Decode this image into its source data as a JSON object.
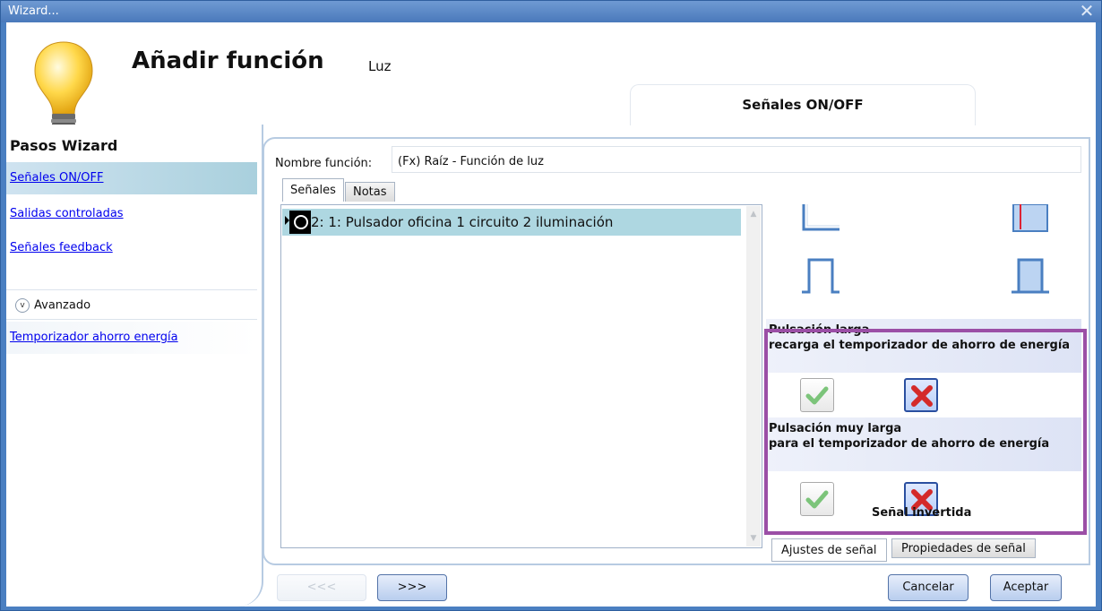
{
  "window": {
    "title": "Wizard...",
    "close_glyph": "✕"
  },
  "header": {
    "title": "Añadir función",
    "subtitle": "Luz",
    "step_tab": "Señales ON/OFF"
  },
  "sidebar": {
    "title": "Pasos Wizard",
    "items": [
      {
        "label": "Señales ON/OFF"
      },
      {
        "label": "Salidas controladas"
      },
      {
        "label": "Señales feedback"
      }
    ],
    "advanced_label": "Avanzado",
    "advanced_items": [
      {
        "label": "Temporizador ahorro energía"
      }
    ]
  },
  "form": {
    "name_label": "Nombre función:",
    "name_value": "(Fx) Raíz - Función de luz"
  },
  "tabs": [
    {
      "label": "Señales"
    },
    {
      "label": "Notas"
    }
  ],
  "signals": [
    {
      "label": "2: 1: Pulsador oficina 1 circuito 2 iluminación"
    }
  ],
  "settings": {
    "long_press": {
      "line1": "Pulsación larga",
      "line2": "recarga el temporizador de ahorro de energía",
      "selected": "no"
    },
    "very_long_press": {
      "line1": "Pulsación muy larga",
      "line2": "para el temporizador de ahorro de energía",
      "selected": "no"
    },
    "inverted_label": "Señal invertida"
  },
  "sub_tabs": [
    {
      "label": "Ajustes de señal"
    },
    {
      "label": "Propiedades de señal"
    }
  ],
  "footer": {
    "back_label": "<<<",
    "next_label": ">>>",
    "cancel_label": "Cancelar",
    "accept_label": "Aceptar"
  },
  "colors": {
    "highlight": "#9b4fa6",
    "accent": "#4a7fc1",
    "active_row": "#aed7e1"
  }
}
